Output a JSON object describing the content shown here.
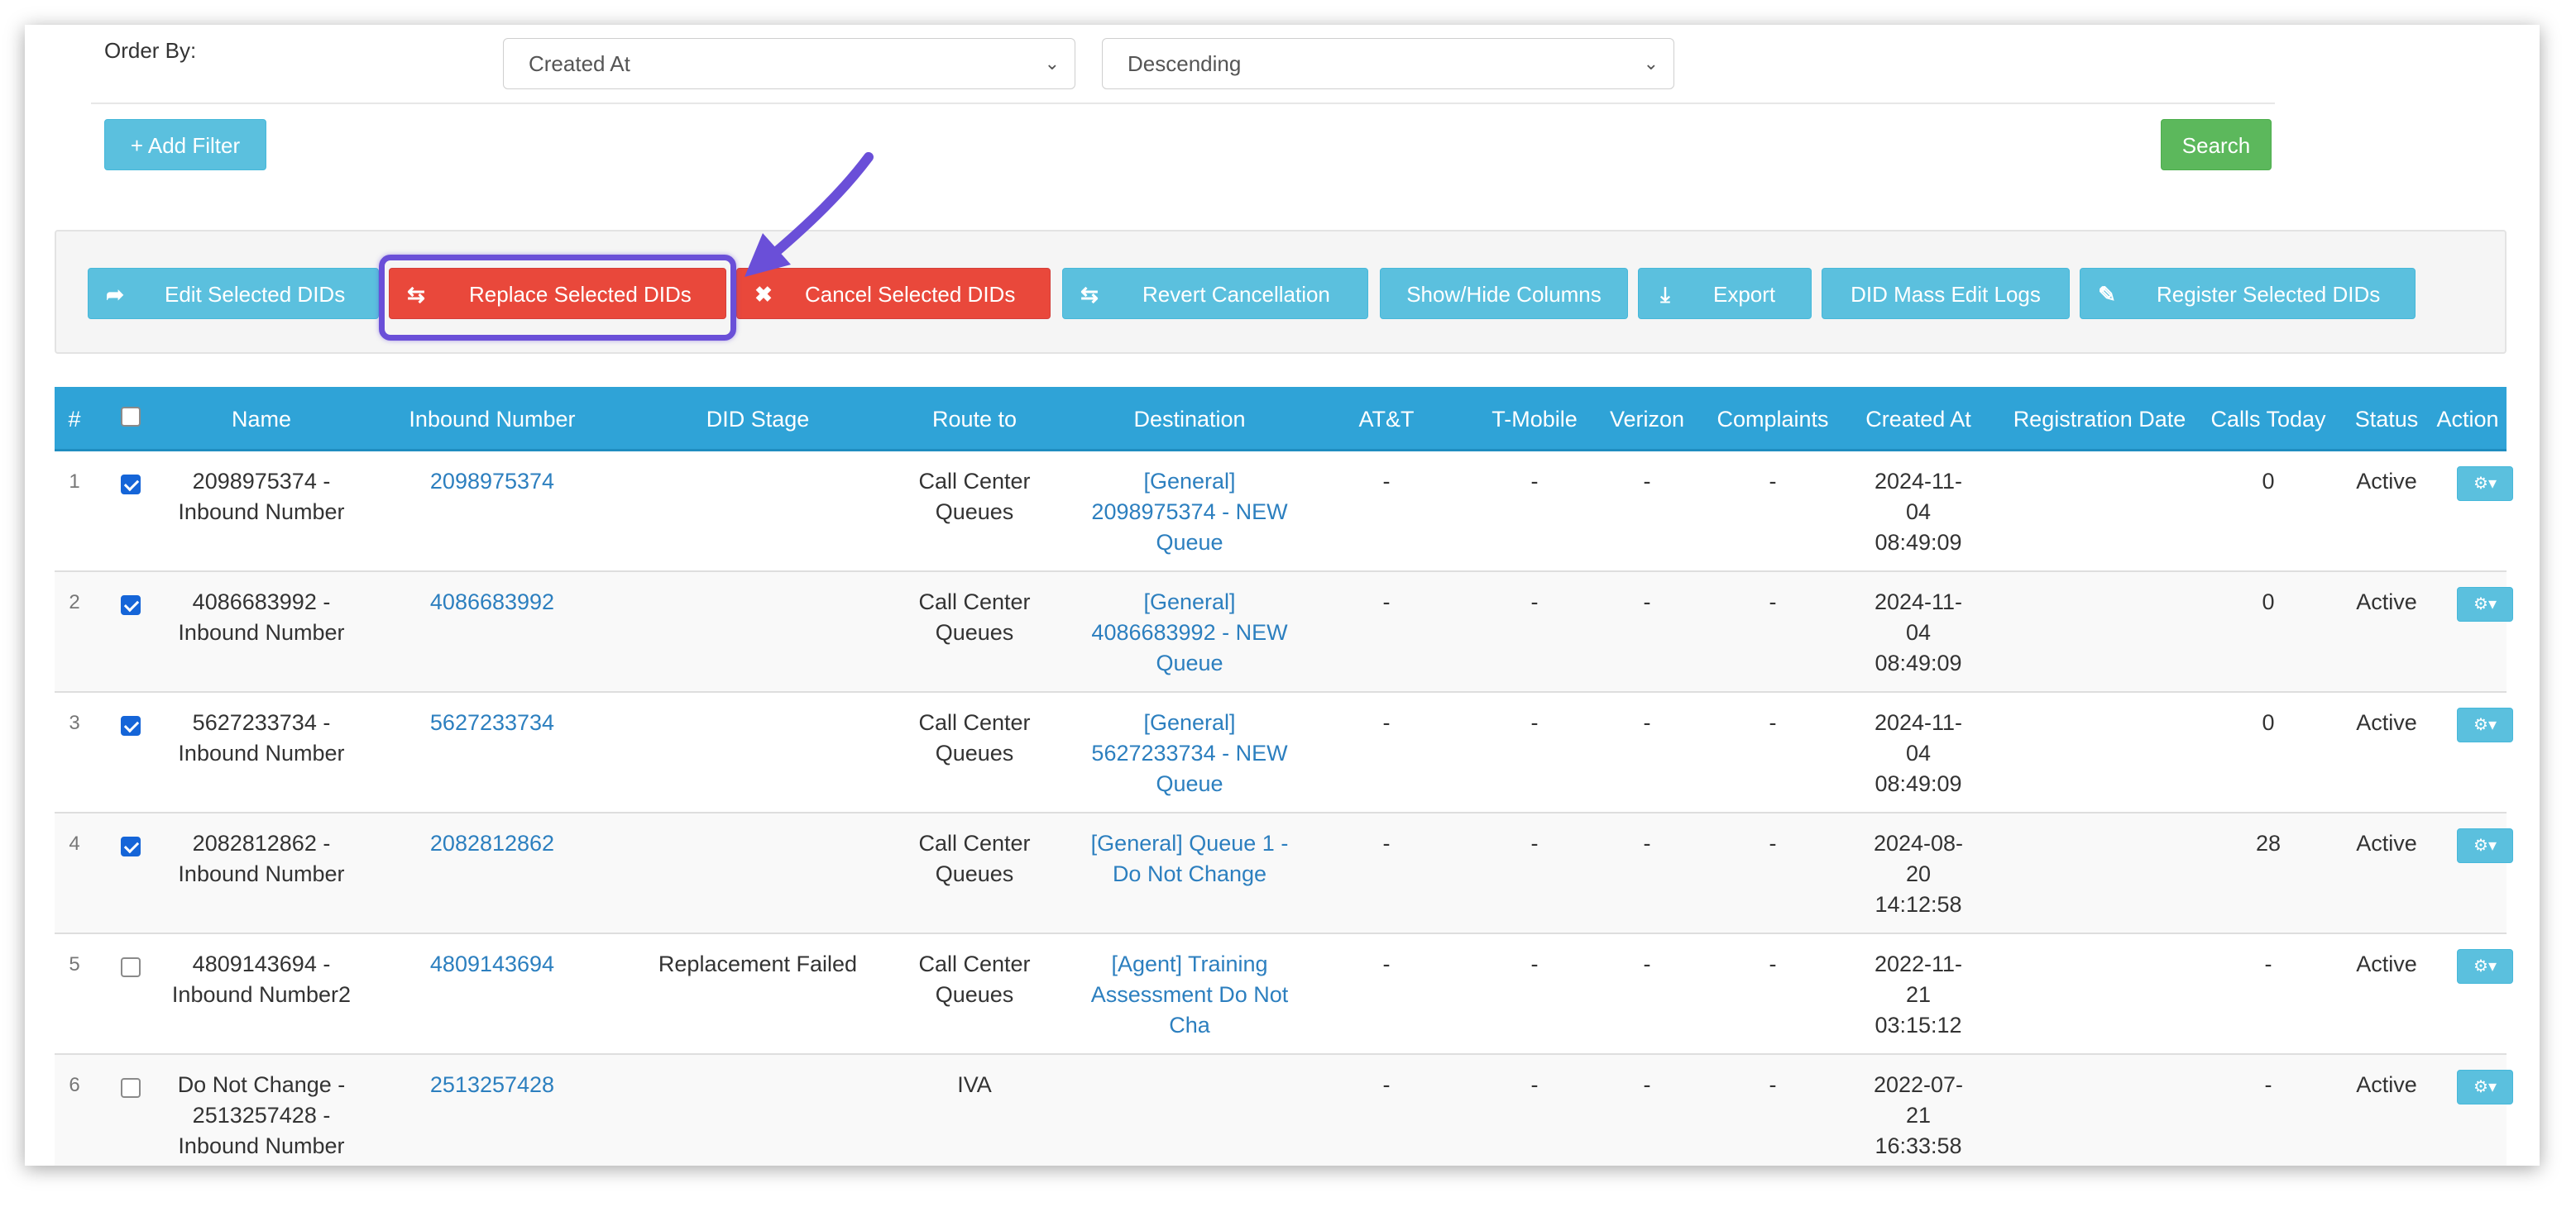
{
  "filters": {
    "order_by_label": "Order By:",
    "order_field": "Created At",
    "order_direction": "Descending",
    "add_filter_label": "+ Add Filter",
    "search_label": "Search"
  },
  "toolbar": {
    "edit_label": "Edit Selected DIDs",
    "replace_label": "Replace Selected DIDs",
    "cancel_label": "Cancel Selected DIDs",
    "revert_label": "Revert Cancellation",
    "columns_label": "Show/Hide Columns",
    "export_label": "Export",
    "logs_label": "DID Mass Edit Logs",
    "register_label": "Register Selected DIDs"
  },
  "table": {
    "headers": {
      "num": "#",
      "name": "Name",
      "inbound": "Inbound Number",
      "stage": "DID Stage",
      "route": "Route to",
      "dest": "Destination",
      "att": "AT&T",
      "tmobile": "T-Mobile",
      "verizon": "Verizon",
      "complaints": "Complaints",
      "created": "Created At",
      "regdate": "Registration Date",
      "calls": "Calls Today",
      "status": "Status",
      "action": "Action"
    },
    "rows": [
      {
        "num": "1",
        "checked": true,
        "name1": "2098975374 -",
        "name2": "Inbound Number",
        "name3": "",
        "inbound": "2098975374",
        "stage": "",
        "route1": "Call Center",
        "route2": "Queues",
        "dest1": "[General]",
        "dest2": "2098975374 - NEW",
        "dest3": "Queue",
        "att": "-",
        "tmobile": "-",
        "verizon": "-",
        "complaints": "-",
        "created1": "2024-11-",
        "created2": "04",
        "created3": "08:49:09",
        "regdate": "",
        "calls": "0",
        "status": "Active"
      },
      {
        "num": "2",
        "checked": true,
        "name1": "4086683992 -",
        "name2": "Inbound Number",
        "name3": "",
        "inbound": "4086683992",
        "stage": "",
        "route1": "Call Center",
        "route2": "Queues",
        "dest1": "[General]",
        "dest2": "4086683992 - NEW",
        "dest3": "Queue",
        "att": "-",
        "tmobile": "-",
        "verizon": "-",
        "complaints": "-",
        "created1": "2024-11-",
        "created2": "04",
        "created3": "08:49:09",
        "regdate": "",
        "calls": "0",
        "status": "Active"
      },
      {
        "num": "3",
        "checked": true,
        "name1": "5627233734 -",
        "name2": "Inbound Number",
        "name3": "",
        "inbound": "5627233734",
        "stage": "",
        "route1": "Call Center",
        "route2": "Queues",
        "dest1": "[General]",
        "dest2": "5627233734 - NEW",
        "dest3": "Queue",
        "att": "-",
        "tmobile": "-",
        "verizon": "-",
        "complaints": "-",
        "created1": "2024-11-",
        "created2": "04",
        "created3": "08:49:09",
        "regdate": "",
        "calls": "0",
        "status": "Active"
      },
      {
        "num": "4",
        "checked": true,
        "name1": "2082812862 -",
        "name2": "Inbound Number",
        "name3": "",
        "inbound": "2082812862",
        "stage": "",
        "route1": "Call Center",
        "route2": "Queues",
        "dest1": "[General] Queue 1 -",
        "dest2": "Do Not Change",
        "dest3": "",
        "att": "-",
        "tmobile": "-",
        "verizon": "-",
        "complaints": "-",
        "created1": "2024-08-",
        "created2": "20",
        "created3": "14:12:58",
        "regdate": "",
        "calls": "28",
        "status": "Active"
      },
      {
        "num": "5",
        "checked": false,
        "name1": "4809143694 -",
        "name2": "Inbound Number2",
        "name3": "",
        "inbound": "4809143694",
        "stage": "Replacement Failed",
        "route1": "Call Center",
        "route2": "Queues",
        "dest1": "[Agent] Training",
        "dest2": "Assessment Do Not",
        "dest3": "Cha",
        "att": "-",
        "tmobile": "-",
        "verizon": "-",
        "complaints": "-",
        "created1": "2022-11-",
        "created2": "21",
        "created3": "03:15:12",
        "regdate": "",
        "calls": "-",
        "status": "Active"
      },
      {
        "num": "6",
        "checked": false,
        "name1": "Do Not Change -",
        "name2": "2513257428 -",
        "name3": "Inbound Number",
        "inbound": "2513257428",
        "stage": "",
        "route1": "IVA",
        "route2": "",
        "dest1": "",
        "dest2": "",
        "dest3": "",
        "att": "-",
        "tmobile": "-",
        "verizon": "-",
        "complaints": "-",
        "created1": "2022-07-",
        "created2": "21",
        "created3": "16:33:58",
        "regdate": "",
        "calls": "-",
        "status": "Active"
      }
    ]
  },
  "colors": {
    "header": "#2fa3d7",
    "info_button": "#5bc0de",
    "danger_button": "#e9483b",
    "success_button": "#5cb85c",
    "highlight": "#6a4fd8",
    "link": "#2c7fbf"
  },
  "icons": {
    "edit": "share-icon",
    "replace": "retweet-icon",
    "cancel": "close-icon",
    "revert": "retweet-icon",
    "export": "download-icon",
    "register": "edit-icon",
    "action": "gear-icon",
    "annotation": "arrow-icon"
  }
}
